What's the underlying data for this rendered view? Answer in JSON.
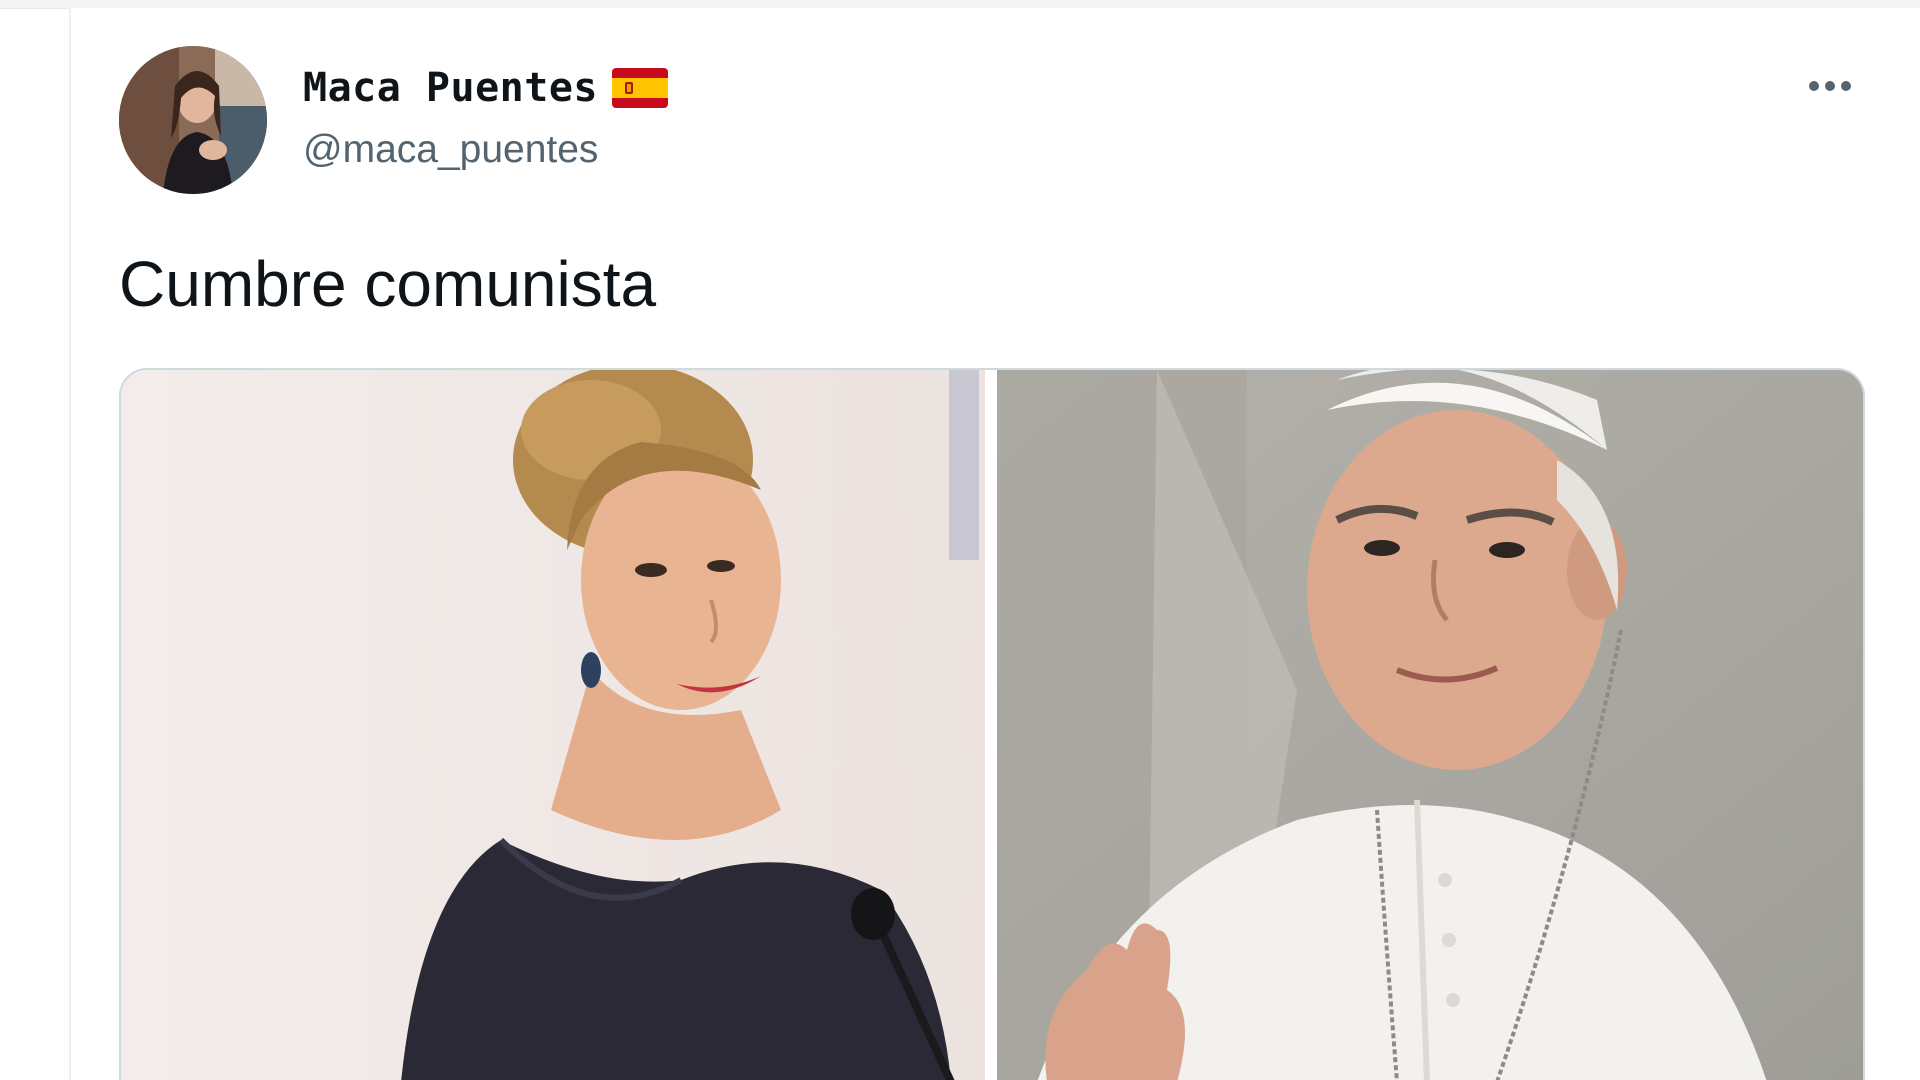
{
  "tweet": {
    "author": {
      "display_name": "Maca Puentes",
      "handle": "@maca_puentes",
      "flag_icon": "spain-flag-icon",
      "avatar_icon": "profile-avatar"
    },
    "text": "Cumbre comunista",
    "more_icon": "more-options-icon",
    "media": [
      {
        "name": "photo-woman-speaking"
      },
      {
        "name": "photo-pope-in-white"
      }
    ]
  },
  "colors": {
    "text_primary": "#0f1419",
    "text_secondary": "#536471",
    "border": "#cfd9de"
  }
}
